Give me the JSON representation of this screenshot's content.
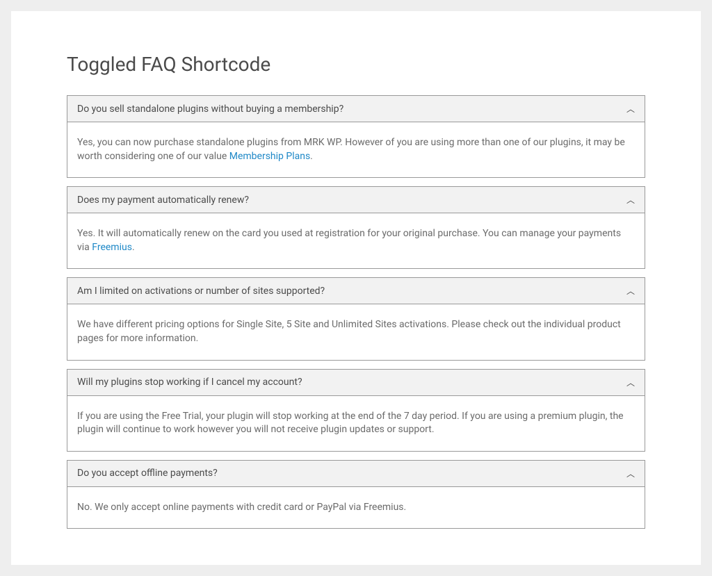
{
  "title": "Toggled FAQ Shortcode",
  "faqs": [
    {
      "question": "Do you sell standalone plugins without buying a membership?",
      "answer_pre": "Yes, you can now purchase standalone plugins from MRK WP. However of you are using more than one of our plugins, it may be worth considering one of our value ",
      "link_text": "Membership Plans",
      "answer_post": "."
    },
    {
      "question": "Does my payment automatically renew?",
      "answer_pre": "Yes. It will automatically renew on the card you used at registration for your original purchase. You can manage your payments via ",
      "link_text": "Freemius",
      "answer_post": "."
    },
    {
      "question": "Am I limited on activations or number of sites supported?",
      "answer_pre": "We have different pricing options for Single Site, 5 Site and Unlimited Sites activations. Please check out the individual product pages for more information.",
      "link_text": "",
      "answer_post": ""
    },
    {
      "question": "Will my plugins stop working if I cancel my account?",
      "answer_pre": "If you are using the Free Trial, your plugin will stop working at the end of the 7 day period. If you are using a premium plugin, the plugin will continue to work however you will not receive plugin updates or support.",
      "link_text": "",
      "answer_post": ""
    },
    {
      "question": "Do you accept offline payments?",
      "answer_pre": "No. We only accept online payments with credit card or PayPal via Freemius.",
      "link_text": "",
      "answer_post": ""
    }
  ]
}
